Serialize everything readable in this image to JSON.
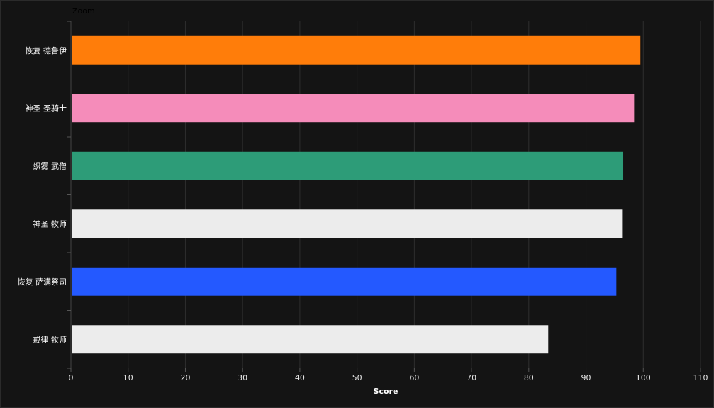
{
  "controls": {
    "zoom_label": "Zoom"
  },
  "chart_data": {
    "type": "bar",
    "orientation": "horizontal",
    "categories": [
      "恢复 德鲁伊",
      "神圣 圣骑士",
      "织雾 武僧",
      "神圣 牧师",
      "恢复 萨满祭司",
      "戒律 牧师"
    ],
    "values": [
      99.5,
      98.4,
      96.5,
      96.3,
      95.3,
      83.4
    ],
    "colors": [
      "#ff7d0a",
      "#f58cba",
      "#2d9c78",
      "#ececec",
      "#2459ff",
      "#ececec"
    ],
    "xlabel": "Score",
    "ylabel": "",
    "xlim": [
      0,
      110
    ],
    "xticks": [
      0,
      10,
      20,
      30,
      40,
      50,
      60,
      70,
      80,
      90,
      100,
      110
    ],
    "grid": true,
    "background": "#141414"
  }
}
